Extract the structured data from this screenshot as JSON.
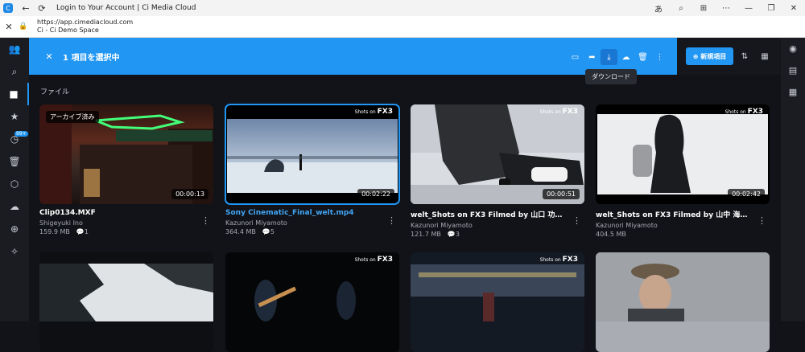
{
  "browser": {
    "tab_title": "Login to Your Account | Ci Media Cloud",
    "url": "https://app.cimediacloud.com",
    "site_subtitle": "Ci - Ci Demo Space"
  },
  "toolbar": {
    "selection_label": "1 項目を選択中",
    "tooltip": "ダウンロード",
    "new_button": "新規項目"
  },
  "left_rail": {
    "badge": "99+"
  },
  "section_title": "ファイル",
  "cards": [
    {
      "name": "Clip0134.MXF",
      "user": "Shigeyuki Ino",
      "size": "159.9 MB",
      "comments": "1",
      "duration": "00:00:13",
      "badge": "アーカイブ済み"
    },
    {
      "name": "Sony Cinematic_Final_welt.mp4",
      "user": "Kazunori Miyamoto",
      "size": "364.4 MB",
      "comments": "5",
      "duration": "00:02:22"
    },
    {
      "name": "welt_Shots on FX3 Filmed by 山口 功貴.m...",
      "user": "Kazunori Miyamoto",
      "size": "121.7 MB",
      "comments": "3",
      "duration": "00:00:51"
    },
    {
      "name": "welt_Shots on FX3 Filmed by 山中 海輝.m...",
      "user": "Kazunori Miyamoto",
      "size": "404.5 MB",
      "comments": "",
      "duration": "00:02:42"
    }
  ],
  "watermark": {
    "prefix": "Shots on",
    "brand": "FX3"
  }
}
